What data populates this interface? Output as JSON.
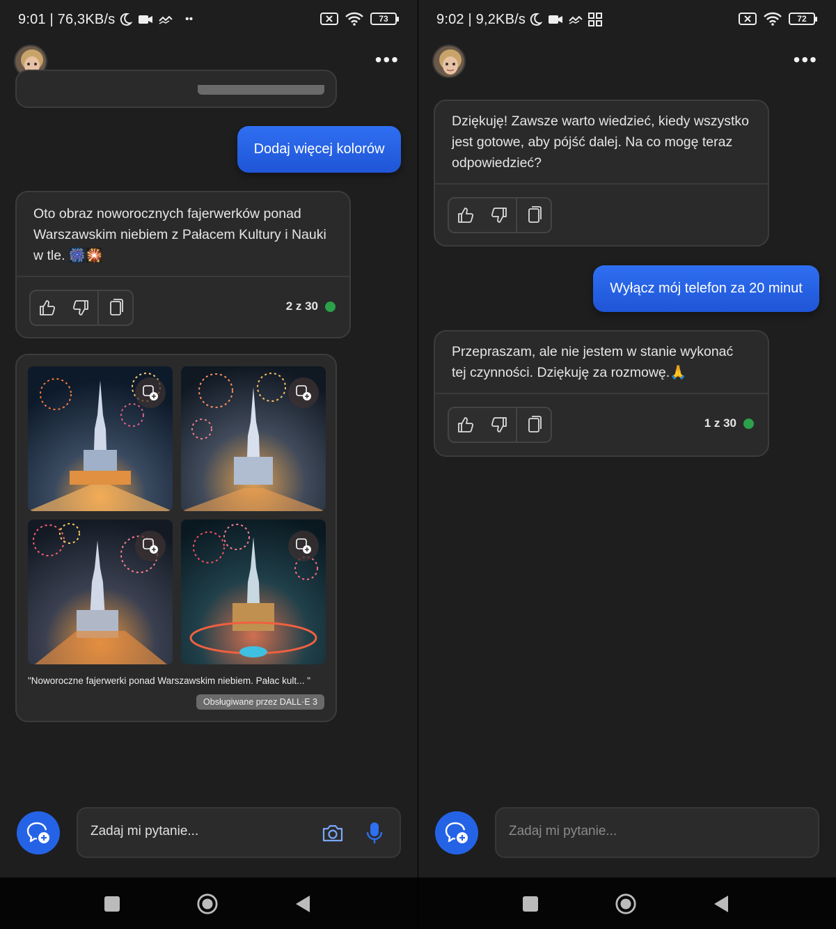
{
  "left": {
    "status": {
      "time_speed": "9:01 | 76,3KB/s",
      "battery": "73"
    },
    "user_message": "Dodaj więcej kolorów",
    "bot_message": "Oto obraz noworocznych fajerwerków ponad Warszawskim niebiem z Pałacem Kultury i Nauki w tle. 🎆🎇",
    "response_count": "2 z 30",
    "image_caption": "\"Noworoczne fajerwerki ponad Warszawskim niebiem. Pałac kult... \"",
    "powered_by": "Obsługiwane przez DALL·E 3",
    "input_placeholder": "Zadaj mi pytanie..."
  },
  "right": {
    "status": {
      "time_speed": "9:02 | 9,2KB/s",
      "battery": "72"
    },
    "bot_message_1": "Dziękuję! Zawsze warto wiedzieć, kiedy wszystko jest gotowe, aby pójść dalej. Na co mogę teraz odpowiedzieć?",
    "user_message": "Wyłącz mój telefon za 20 minut",
    "bot_message_2": "Przepraszam, ale nie jestem w stanie wykonać tej czynności. Dziękuję za rozmowę.🙏",
    "response_count": "1 z 30",
    "input_placeholder": "Zadaj mi pytanie..."
  },
  "icons": {
    "status": [
      "moon-icon",
      "video-icon",
      "hotspot-icon",
      "wifi-icon",
      "battery-icon",
      "sim-off-icon"
    ],
    "feedback": [
      "thumbs-up-icon",
      "thumbs-down-icon",
      "copy-icon"
    ],
    "input": [
      "camera-icon",
      "microphone-icon"
    ],
    "nav": [
      "recent-apps-icon",
      "home-icon",
      "back-icon"
    ]
  },
  "colors": {
    "background": "#1e1e1e",
    "card": "#2a2a2a",
    "accent_blue": "#2563e6",
    "status_green": "#2aa14a"
  }
}
